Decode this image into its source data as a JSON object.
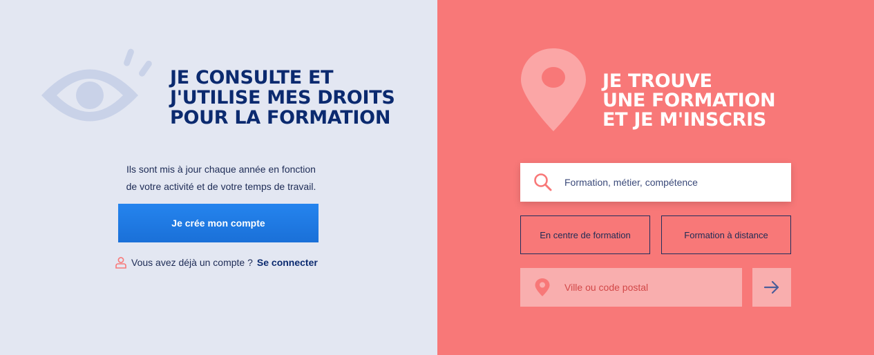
{
  "left_panel": {
    "title_lines": [
      "JE CONSULTE ET",
      "J'UTILISE MES DROITS",
      "POUR LA FORMATION"
    ],
    "desc_lines": [
      "Ils sont mis à jour chaque année en fonction",
      "de votre activité et de votre temps de travail."
    ],
    "create_button": "Je crée mon compte",
    "login_prompt": "Vous avez déjà un compte ?",
    "login_link": "Se connecter",
    "icons": {
      "eye": "eye-icon",
      "user": "user-icon"
    },
    "colors": {
      "background": "#e3e7f2",
      "title": "#0b2a6f",
      "button": "#1f7ae6",
      "accent": "#f87878"
    }
  },
  "right_panel": {
    "title_lines": [
      "JE TROUVE",
      "UNE FORMATION",
      "ET JE M'INSCRIS"
    ],
    "search": {
      "placeholder": "Formation, métier, compétence"
    },
    "modes": [
      "En centre de formation",
      "Formation à distance"
    ],
    "city": {
      "placeholder": "Ville ou code postal"
    },
    "icons": {
      "pin": "map-pin-icon",
      "search": "search-icon",
      "location": "location-icon",
      "submit": "arrow-right-icon"
    },
    "colors": {
      "background": "#f87878",
      "field": "#f9aeae",
      "title": "#ffffff"
    }
  }
}
